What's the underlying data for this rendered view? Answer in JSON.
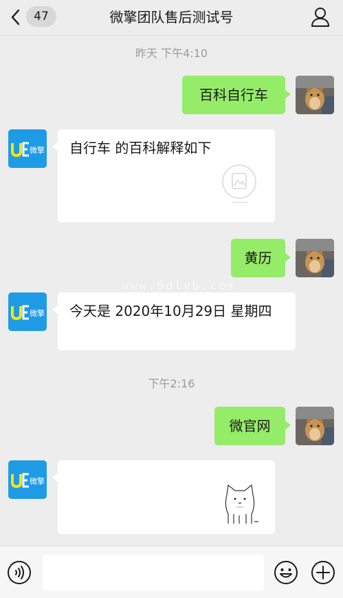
{
  "header": {
    "unread_count": "47",
    "title": "微擎团队售后测试号"
  },
  "bot_logo_text": "微擎",
  "messages": [
    {
      "type": "time",
      "text": "昨天 下午4:10"
    },
    {
      "type": "outgoing",
      "text": "百科自行车"
    },
    {
      "type": "incoming",
      "text": "自行车 的百科解释如下"
    },
    {
      "type": "outgoing",
      "text": "黄历"
    },
    {
      "type": "incoming",
      "text": "今天是 2020年10月29日 星期四"
    },
    {
      "type": "time",
      "text": "下午2:16"
    },
    {
      "type": "outgoing",
      "text": "微官网"
    },
    {
      "type": "incoming",
      "text": ""
    }
  ],
  "watermark": "www.9dlyb.com",
  "input_bar": {
    "input_value": "",
    "icons": [
      "voice-icon",
      "emoji-icon",
      "plus-icon"
    ]
  },
  "colors": {
    "background": "#ededed",
    "outgoing_bubble": "#95ec69",
    "incoming_bubble": "#ffffff",
    "bot_avatar": "#1f9be6"
  }
}
